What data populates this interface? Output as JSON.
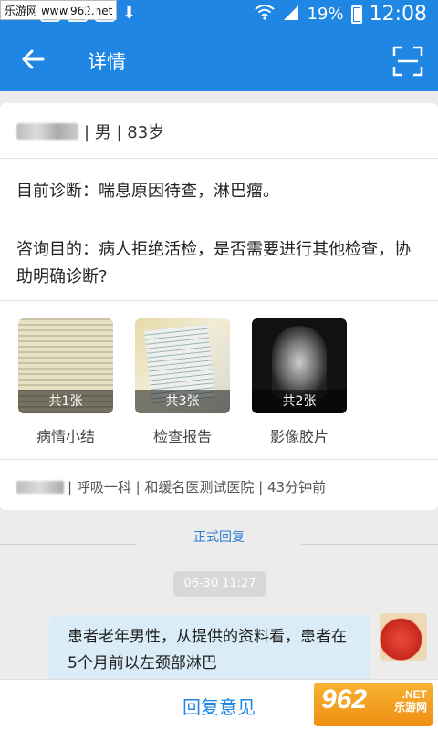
{
  "statusbar": {
    "watermark": "乐游网 www.962.net",
    "battery": "19%",
    "time": "12:08"
  },
  "header": {
    "title": "详情",
    "back_icon": "back-arrow-icon",
    "scan_icon": "scan-icon"
  },
  "patient": {
    "info": "| 男 | 83岁"
  },
  "diagnosis": "目前诊断：喘息原因待查，淋巴瘤。",
  "purpose": "咨询目的：病人拒绝活检，是否需要进行其他检查，协助明确诊断?",
  "attachments": [
    {
      "count": "共1张",
      "label": "病情小结"
    },
    {
      "count": "共3张",
      "label": "检查报告"
    },
    {
      "count": "共2张",
      "label": "影像胶片"
    }
  ],
  "meta": "| 呼吸一科 | 和缓名医测试医院 | 43分钟前",
  "reply": {
    "section_label": "正式回复",
    "timestamp": "06-30 11:27",
    "message": "患者老年男性，从提供的资料看，患者在5个月前以左颈部淋巴"
  },
  "bottom": {
    "reply_button": "回复意见"
  },
  "logo": {
    "big": "962",
    "small_top": ".NET",
    "small_bottom": "乐游网"
  },
  "colors": {
    "brand": "#1f87e3",
    "bubble": "#d9ecf7"
  }
}
